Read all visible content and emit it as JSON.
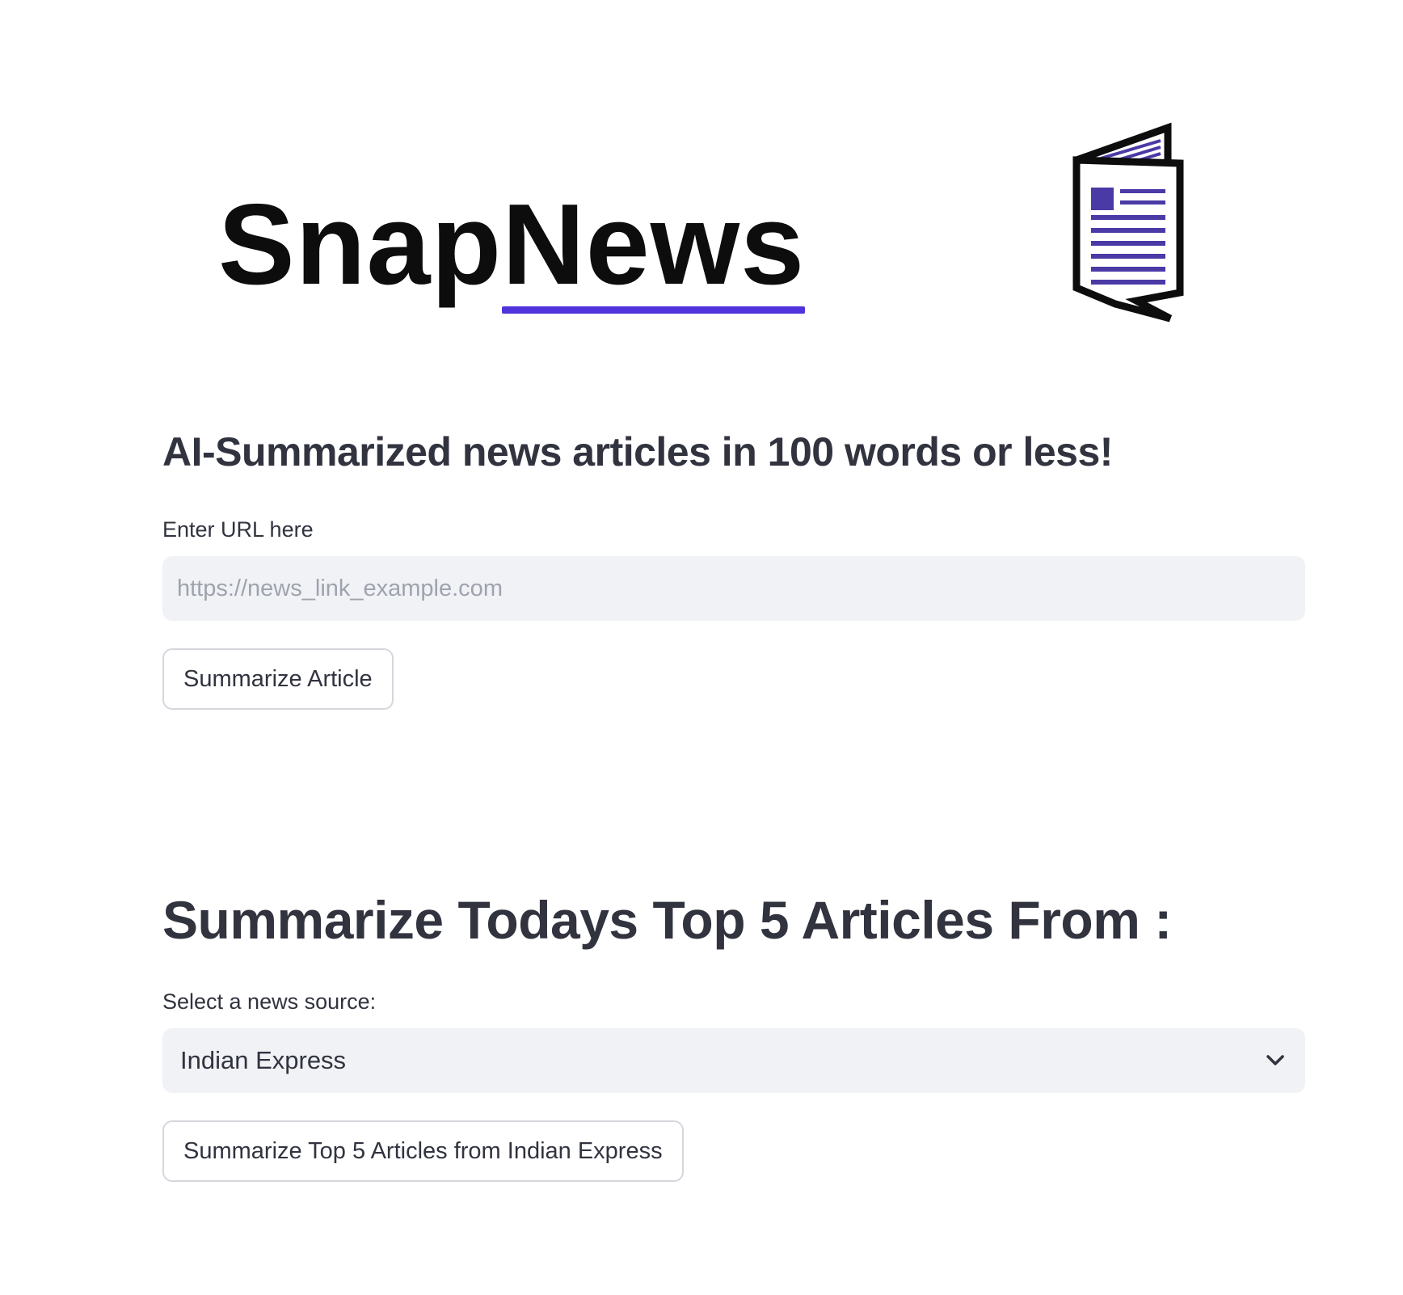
{
  "brand": {
    "name_part1": "Snap",
    "name_part2": "News",
    "logo_icon": "newspaper-icon",
    "accent_color": "#5033dc"
  },
  "tagline": "AI-Summarized news articles in 100 words or less!",
  "url_section": {
    "label": "Enter URL here",
    "input_value": "",
    "placeholder": "https://news_link_example.com",
    "button_label": "Summarize Article"
  },
  "top_articles_section": {
    "heading": "Summarize Todays Top 5 Articles From :",
    "select_label": "Select a news source:",
    "selected_source": "Indian Express",
    "select_icon": "chevron-down-icon",
    "button_label": "Summarize Top 5 Articles from Indian Express"
  }
}
